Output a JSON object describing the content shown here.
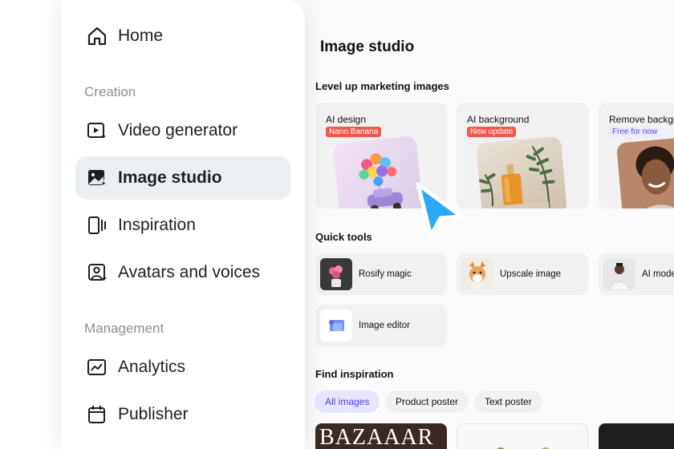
{
  "sidebar": {
    "home": "Home",
    "creation_label": "Creation",
    "items_creation": [
      {
        "label": "Video generator",
        "icon": "video-generator-icon"
      },
      {
        "label": "Image studio",
        "icon": "image-studio-icon"
      },
      {
        "label": "Inspiration",
        "icon": "inspiration-icon"
      },
      {
        "label": "Avatars and voices",
        "icon": "avatar-icon"
      }
    ],
    "management_label": "Management",
    "items_management": [
      {
        "label": "Analytics",
        "icon": "analytics-icon"
      },
      {
        "label": "Publisher",
        "icon": "calendar-icon"
      }
    ]
  },
  "main": {
    "title": "Image studio",
    "marketing_heading": "Level up marketing images",
    "feature_cards": [
      {
        "title": "AI design",
        "badge": "Nano Banana"
      },
      {
        "title": "AI background",
        "badge": "New update"
      },
      {
        "title": "Remove backgr",
        "badge": "Free for now"
      }
    ],
    "quick_tools_heading": "Quick tools",
    "quick_tools": [
      {
        "label": "Rosify magic"
      },
      {
        "label": "Upscale image"
      },
      {
        "label": "AI mode"
      },
      {
        "label": "Image editor"
      }
    ],
    "inspiration_heading": "Find inspiration",
    "chips": [
      "All images",
      "Product poster",
      "Text poster"
    ],
    "inspiration_card_text": "BAZAAAR"
  },
  "colors": {
    "accent": "#4a3fe0",
    "badge_red": "#f0584a",
    "cursor_blue": "#29a8f5",
    "active_nav": "#eceff1"
  }
}
